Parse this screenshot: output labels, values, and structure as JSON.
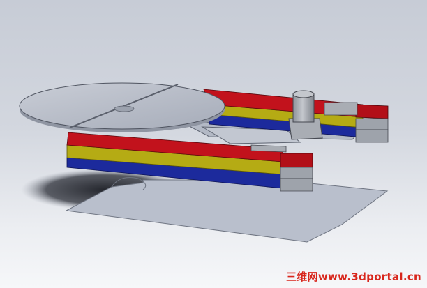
{
  "watermark": {
    "text": "三维网www.3dportal.cn",
    "color": "#d8261c"
  },
  "colors": {
    "background_top": "#c7ccd6",
    "background_bottom": "#f6f7f9",
    "base_plate": "#b9bfcc",
    "turntable_disc": "#b7bcc8",
    "rail_red": "#c2121c",
    "rail_yellow": "#b5ab14",
    "rail_blue": "#1c2a9c",
    "motor_housing": "#a9adb4",
    "shadow": "#1b1d24"
  }
}
